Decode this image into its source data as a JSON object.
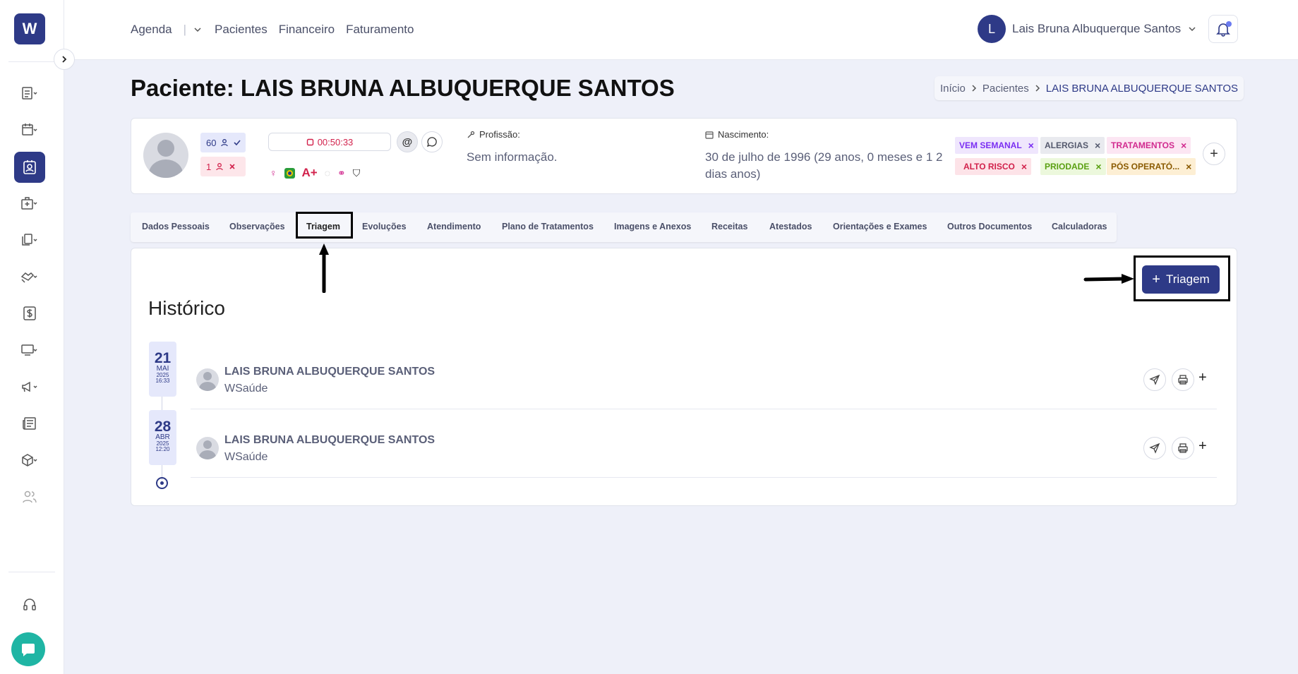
{
  "sidebar": {
    "logo": "W",
    "items": [
      {
        "icon": "clipboard-list-icon"
      },
      {
        "icon": "calendar-icon"
      },
      {
        "icon": "patient-card-icon",
        "active": true
      },
      {
        "icon": "hospital-icon"
      },
      {
        "icon": "documents-icon"
      },
      {
        "icon": "handshake-icon"
      },
      {
        "icon": "dollar-icon"
      },
      {
        "icon": "monitor-icon"
      },
      {
        "icon": "megaphone-icon"
      },
      {
        "icon": "newspaper-icon"
      },
      {
        "icon": "box-icon"
      },
      {
        "icon": "users-icon"
      }
    ],
    "support_icon": "headset-icon",
    "chat_icon": "chat-icon"
  },
  "topbar": {
    "nav": [
      "Agenda",
      "Pacientes",
      "Financeiro",
      "Faturamento"
    ],
    "user_initial": "L",
    "user_name": "Lais Bruna Albuquerque Santos"
  },
  "page": {
    "title": "Paciente: LAIS BRUNA ALBUQUERQUE SANTOS",
    "breadcrumb": [
      "Início",
      "Pacientes",
      "LAIS BRUNA ALBUQUERQUE SANTOS"
    ]
  },
  "patient": {
    "count_blue": "60",
    "count_red": "1",
    "timer": "00:50:33",
    "blood_type": "A+",
    "profession_label": "Profissão:",
    "profession_value": "Sem informação.",
    "birth_label": "Nascimento:",
    "birth_value": "30 de julho de 1996 (29 anos, 0 meses e 1 2 dias anos)",
    "tags": [
      {
        "label": "VEM SEMANAL",
        "color": "#7b2ff2",
        "bg": "#efe6fd"
      },
      {
        "label": "ALERGIAS",
        "color": "#555a6e",
        "bg": "#e9eaef"
      },
      {
        "label": "TRATAMENTOS",
        "color": "#d12a8f",
        "bg": "#fce6f3"
      },
      {
        "label": "ALTO RISCO",
        "color": "#d2224c",
        "bg": "#fde3e8"
      },
      {
        "label": "PRIODADE",
        "color": "#5aa012",
        "bg": "#ecf8dc"
      },
      {
        "label": "PÓS OPERATÓ...",
        "color": "#8a5a00",
        "bg": "#fdefd4"
      }
    ]
  },
  "tabs": [
    "Dados Pessoais",
    "Observações",
    "Triagem",
    "Evoluções",
    "Atendimento",
    "Plano de Tratamentos",
    "Imagens e Anexos",
    "Receitas",
    "Atestados",
    "Orientações e Exames",
    "Outros Documentos",
    "Calculadoras"
  ],
  "main": {
    "add_button": "Triagem",
    "history_title": "Histórico",
    "entries": [
      {
        "day": "21",
        "month": "MAI",
        "year": "2025",
        "time": "16:33",
        "name": "LAIS BRUNA ALBUQUERQUE SANTOS",
        "org": "WSaúde"
      },
      {
        "day": "28",
        "month": "ABR",
        "year": "2025",
        "time": "12:20",
        "name": "LAIS BRUNA ALBUQUERQUE SANTOS",
        "org": "WSaúde"
      }
    ]
  }
}
